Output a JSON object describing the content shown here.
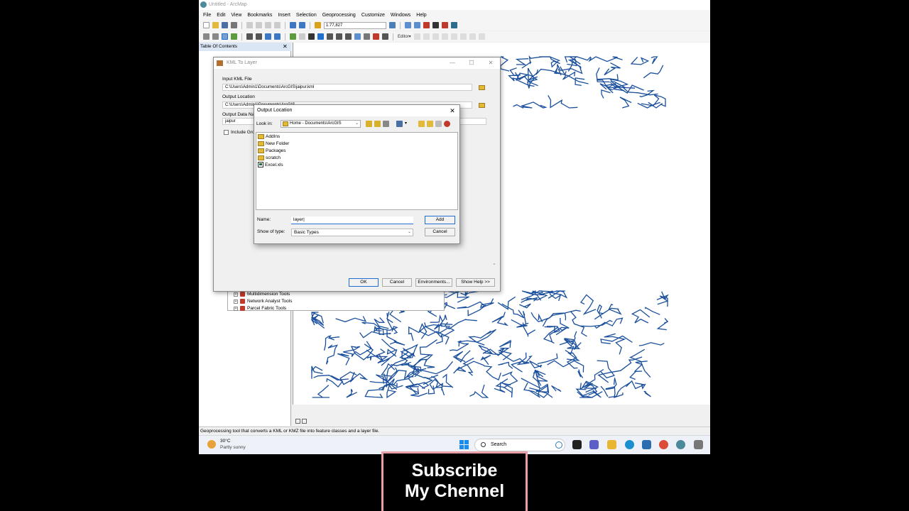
{
  "window": {
    "title": "Untitled - ArcMap"
  },
  "menu": [
    "File",
    "Edit",
    "View",
    "Bookmarks",
    "Insert",
    "Selection",
    "Geoprocessing",
    "Customize",
    "Windows",
    "Help"
  ],
  "toolbar": {
    "scale": "1:77,827",
    "editor_label": "Editor▾"
  },
  "toc": {
    "title": "Table Of Contents"
  },
  "toolbox_items": [
    "Multidimension Tools",
    "Network Analyst Tools",
    "Parcel Fabric Tools"
  ],
  "kml_dialog": {
    "title": "KML To Layer",
    "input_label": "Input KML File",
    "input_value": "C:\\Users\\Admin1\\Documents\\ArcGIS\\jaipur.kml",
    "output_location_label": "Output Location",
    "output_location_value": "C:\\Users\\Admin1\\Documents\\ArcGIS",
    "output_name_label": "Output Data Name",
    "output_name_value": "jaipur",
    "include_ground_label": "Include Ground",
    "ok": "OK",
    "cancel": "Cancel",
    "environments": "Environments...",
    "show_help": "Show Help >>"
  },
  "output_dialog": {
    "title": "Output Location",
    "lookin_label": "Look in:",
    "lookin_value": "Home - Documents\\ArcGIS",
    "files": [
      {
        "name": "AddIns",
        "type": "folder"
      },
      {
        "name": "New Folder",
        "type": "folder"
      },
      {
        "name": "Packages",
        "type": "folder"
      },
      {
        "name": "scratch",
        "type": "folder"
      },
      {
        "name": "Excel.xls",
        "type": "file"
      }
    ],
    "name_label": "Name:",
    "name_value": "layer|",
    "type_label": "Show of type:",
    "type_value": "Basic Types",
    "add": "Add",
    "cancel": "Cancel"
  },
  "status": {
    "text": "Geoprocessing tool that converts a KML or KMZ file into feature classes and a layer file."
  },
  "taskbar": {
    "temp": "30°C",
    "weather": "Partly sunny",
    "search_placeholder": "Search"
  },
  "banner": {
    "line1": "Subscribe",
    "line2": "My Chennel"
  },
  "colors": {
    "road": "#1a4f9c",
    "accent": "#1f6fd0",
    "banner_border": "#e8a0a8"
  }
}
